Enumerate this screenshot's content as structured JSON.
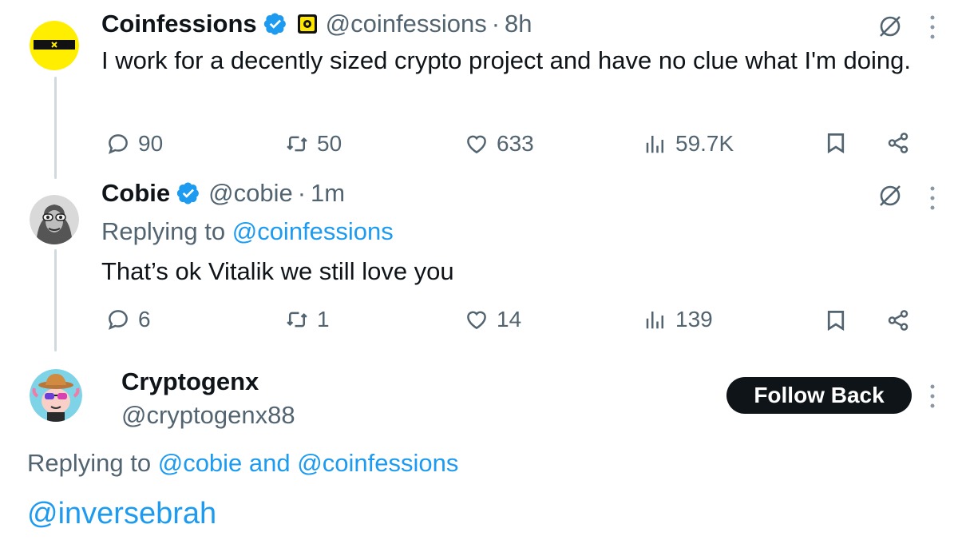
{
  "colors": {
    "accent": "#1d9bf0",
    "text": "#0f1419",
    "muted": "#536471",
    "line": "#cfd9de",
    "button_bg": "#0f1419"
  },
  "tweets": [
    {
      "name": "Coinfessions",
      "handle": "@coinfessions",
      "separator": "·",
      "time": "8h",
      "text": "I work for a decently sized crypto project and have no clue what I'm doing.",
      "actions": {
        "replies": "90",
        "retweets": "50",
        "likes": "633",
        "views": "59.7K"
      }
    },
    {
      "name": "Cobie",
      "handle": "@cobie",
      "separator": "·",
      "time": "1m",
      "replying_prefix": "Replying to ",
      "replying_to": "@coinfessions",
      "text": "That’s ok Vitalik we still love you",
      "actions": {
        "replies": "6",
        "retweets": "1",
        "likes": "14",
        "views": "139"
      }
    }
  ],
  "reply": {
    "name": "Cryptogenx",
    "handle": "@cryptogenx88",
    "follow_label": "Follow Back",
    "replying_prefix": "Replying to ",
    "replying_user1": "@cobie",
    "replying_and": " and ",
    "replying_user2": "@coinfessions",
    "text": "@inversebrah"
  },
  "icons": [
    "reply-icon",
    "retweet-icon",
    "like-icon",
    "views-icon",
    "bookmark-icon",
    "share-icon",
    "grok-icon",
    "more-icon",
    "verified-icon"
  ]
}
